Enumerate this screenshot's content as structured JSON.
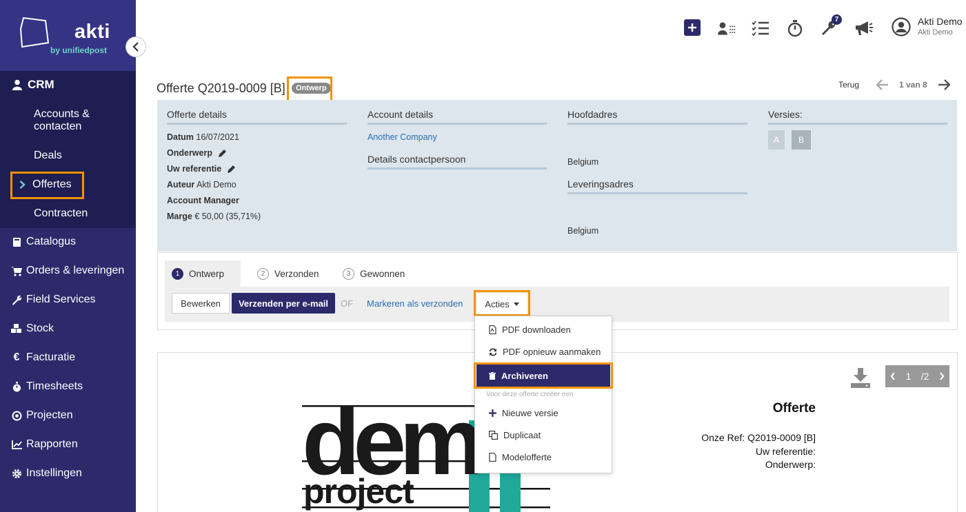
{
  "brand": {
    "name": "akti",
    "sub": "by unifiedpost"
  },
  "sidebar": {
    "crm_label": "CRM",
    "crm_items": [
      {
        "label": "Accounts & contacten"
      },
      {
        "label": "Deals"
      },
      {
        "label": "Offertes"
      },
      {
        "label": "Contracten"
      }
    ],
    "items": [
      {
        "label": "Catalogus",
        "icon": "book-icon"
      },
      {
        "label": "Orders & leveringen",
        "icon": "cart-icon"
      },
      {
        "label": "Field Services",
        "icon": "wrench-icon"
      },
      {
        "label": "Stock",
        "icon": "boxes-icon"
      },
      {
        "label": "Facturatie",
        "icon": "euro-icon"
      },
      {
        "label": "Timesheets",
        "icon": "stopwatch-icon"
      },
      {
        "label": "Projecten",
        "icon": "target-icon"
      },
      {
        "label": "Rapporten",
        "icon": "chart-icon"
      },
      {
        "label": "Instellingen",
        "icon": "gear-icon"
      }
    ]
  },
  "topbar": {
    "notification_count": "7",
    "user_name": "Akti Demo",
    "user_company": "Akti Demo"
  },
  "header": {
    "title": "Offerte Q2019-0009 [B]",
    "status": "Ontwerp",
    "back_label": "Terug",
    "pager": "1 van 8"
  },
  "details": {
    "offer_heading": "Offerte details",
    "datum_label": "Datum",
    "datum_value": "16/07/2021",
    "onderwerp_label": "Onderwerp",
    "referentie_label": "Uw referentie",
    "auteur_label": "Auteur",
    "auteur_value": "Akti Demo",
    "manager_label": "Account Manager",
    "marge_label": "Marge",
    "marge_value": "€ 50,00 (35,71%)",
    "account_heading": "Account details",
    "account_name": "Another Company",
    "contact_heading": "Details contactpersoon",
    "hoofdadres_heading": "Hoofdadres",
    "hoofdadres_country": "Belgium",
    "levering_heading": "Leveringsadres",
    "levering_country": "Belgium",
    "versions_heading": "Versies:",
    "versions": [
      "A",
      "B"
    ]
  },
  "steps": [
    {
      "num": "1",
      "label": "Ontwerp"
    },
    {
      "num": "2",
      "label": "Verzonden"
    },
    {
      "num": "3",
      "label": "Gewonnen"
    }
  ],
  "actions": {
    "edit": "Bewerken",
    "send_email": "Verzenden per e-mail",
    "or": "OF",
    "mark_sent": "Markeren als verzonden",
    "acties": "Acties"
  },
  "dropdown": {
    "pdf_download": "PDF downloaden",
    "pdf_regenerate": "PDF opnieuw aanmaken",
    "archive": "Archiveren",
    "section_label": "Voor deze offerte creëer een",
    "new_version": "Nieuwe versie",
    "duplicate": "Duplicaat",
    "model": "Modelofferte"
  },
  "document": {
    "page_current": "1",
    "page_total": "/2",
    "title": "Offerte",
    "ref_line": "Onze Ref: Q2019-0009 [B]",
    "uw_ref_line": "Uw referentie:",
    "onderwerp_line": "Onderwerp:",
    "logo_word_top": "dem",
    "logo_word_bottom": "project"
  },
  "colors": {
    "sidebar": "#2c2a6b",
    "crm_bg": "#1f1e52",
    "highlight": "#f39200",
    "primary_btn": "#2c2a6b",
    "panel": "#dde6ed",
    "teal": "#20a89a"
  }
}
